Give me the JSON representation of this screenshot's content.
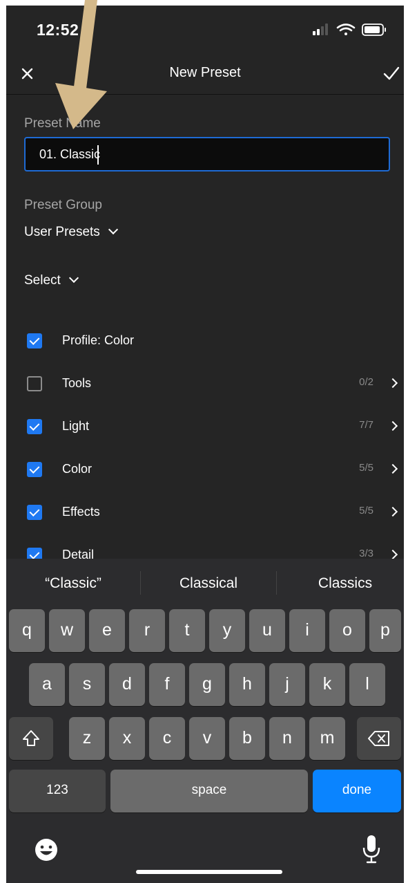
{
  "status_bar": {
    "time": "12:52"
  },
  "nav": {
    "title": "New Preset"
  },
  "form": {
    "name_label": "Preset Name",
    "name_value": "01. Classic",
    "group_label": "Preset Group",
    "group_value": "User Presets",
    "select_label": "Select"
  },
  "settings": [
    {
      "label": "Profile: Color",
      "checked": true,
      "count": "",
      "has_chevron": false
    },
    {
      "label": "Tools",
      "checked": false,
      "count": "0/2",
      "has_chevron": true
    },
    {
      "label": "Light",
      "checked": true,
      "count": "7/7",
      "has_chevron": true
    },
    {
      "label": "Color",
      "checked": true,
      "count": "5/5",
      "has_chevron": true
    },
    {
      "label": "Effects",
      "checked": true,
      "count": "5/5",
      "has_chevron": true
    },
    {
      "label": "Detail",
      "checked": true,
      "count": "3/3",
      "has_chevron": true
    }
  ],
  "keyboard": {
    "suggestions": [
      "“Classic”",
      "Classical",
      "Classics"
    ],
    "row1": [
      "q",
      "w",
      "e",
      "r",
      "t",
      "y",
      "u",
      "i",
      "o",
      "p"
    ],
    "row2": [
      "a",
      "s",
      "d",
      "f",
      "g",
      "h",
      "j",
      "k",
      "l"
    ],
    "row3": [
      "z",
      "x",
      "c",
      "v",
      "b",
      "n",
      "m"
    ],
    "numbers_label": "123",
    "space_label": "space",
    "done_label": "done"
  },
  "icons": [
    "close-icon",
    "checkmark-icon",
    "signal-icon",
    "wifi-icon",
    "battery-icon",
    "chevron-down-icon",
    "chevron-right-icon",
    "shift-icon",
    "backspace-icon",
    "emoji-icon",
    "microphone-icon",
    "annotation-arrow"
  ],
  "colors": {
    "accent": "#1f79f2",
    "done_key": "#0a84ff",
    "background": "#252525",
    "arrow": "#d4b98a"
  }
}
